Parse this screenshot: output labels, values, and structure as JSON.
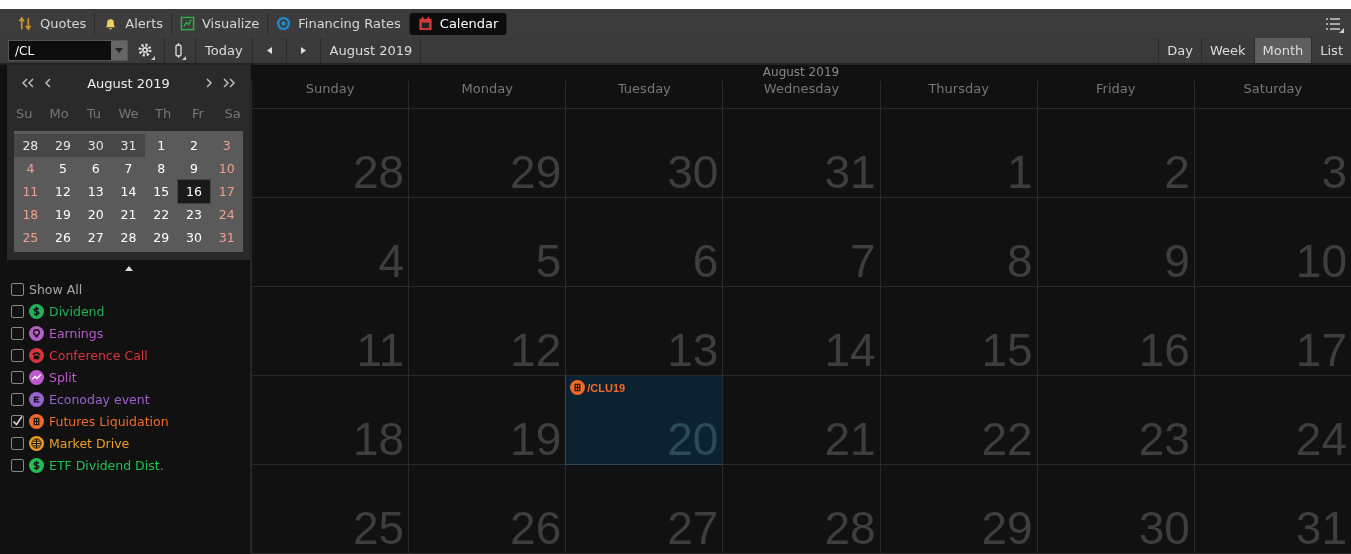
{
  "tabs": [
    {
      "label": "Quotes",
      "selected": false
    },
    {
      "label": "Alerts",
      "selected": false
    },
    {
      "label": "Visualize",
      "selected": false
    },
    {
      "label": "Financing Rates",
      "selected": false
    },
    {
      "label": "Calendar",
      "selected": true
    }
  ],
  "toolbar": {
    "symbol": "/CL",
    "today": "Today",
    "period": "August 2019"
  },
  "views": [
    {
      "label": "Day",
      "selected": false
    },
    {
      "label": "Week",
      "selected": false
    },
    {
      "label": "Month",
      "selected": true
    },
    {
      "label": "List",
      "selected": false
    }
  ],
  "mini_calendar": {
    "title": "August 2019",
    "weekdays": [
      "Su",
      "Mo",
      "Tu",
      "We",
      "Th",
      "Fr",
      "Sa"
    ],
    "weeks": [
      [
        {
          "day": "28",
          "other_month": true,
          "selected": false
        },
        {
          "day": "29",
          "other_month": true,
          "selected": false
        },
        {
          "day": "30",
          "other_month": true,
          "selected": false
        },
        {
          "day": "31",
          "other_month": true,
          "selected": false
        },
        {
          "day": "1",
          "other_month": false,
          "selected": false
        },
        {
          "day": "2",
          "other_month": false,
          "selected": false
        },
        {
          "day": "3",
          "other_month": false,
          "selected": false
        }
      ],
      [
        {
          "day": "4",
          "other_month": false,
          "selected": false
        },
        {
          "day": "5",
          "other_month": false,
          "selected": false
        },
        {
          "day": "6",
          "other_month": false,
          "selected": false
        },
        {
          "day": "7",
          "other_month": false,
          "selected": false
        },
        {
          "day": "8",
          "other_month": false,
          "selected": false
        },
        {
          "day": "9",
          "other_month": false,
          "selected": false
        },
        {
          "day": "10",
          "other_month": false,
          "selected": false
        }
      ],
      [
        {
          "day": "11",
          "other_month": false,
          "selected": false
        },
        {
          "day": "12",
          "other_month": false,
          "selected": false
        },
        {
          "day": "13",
          "other_month": false,
          "selected": false
        },
        {
          "day": "14",
          "other_month": false,
          "selected": false
        },
        {
          "day": "15",
          "other_month": false,
          "selected": false
        },
        {
          "day": "16",
          "other_month": false,
          "selected": true
        },
        {
          "day": "17",
          "other_month": false,
          "selected": false
        }
      ],
      [
        {
          "day": "18",
          "other_month": false,
          "selected": false
        },
        {
          "day": "19",
          "other_month": false,
          "selected": false
        },
        {
          "day": "20",
          "other_month": false,
          "selected": false
        },
        {
          "day": "21",
          "other_month": false,
          "selected": false
        },
        {
          "day": "22",
          "other_month": false,
          "selected": false
        },
        {
          "day": "23",
          "other_month": false,
          "selected": false
        },
        {
          "day": "24",
          "other_month": false,
          "selected": false
        }
      ],
      [
        {
          "day": "25",
          "other_month": false,
          "selected": false
        },
        {
          "day": "26",
          "other_month": false,
          "selected": false
        },
        {
          "day": "27",
          "other_month": false,
          "selected": false
        },
        {
          "day": "28",
          "other_month": false,
          "selected": false
        },
        {
          "day": "29",
          "other_month": false,
          "selected": false
        },
        {
          "day": "30",
          "other_month": false,
          "selected": false
        },
        {
          "day": "31",
          "other_month": false,
          "selected": false
        }
      ]
    ]
  },
  "filters": [
    {
      "label": "Show All",
      "checked": false
    },
    {
      "label": "Dividend",
      "checked": false,
      "color": "#1fb25a"
    },
    {
      "label": "Earnings",
      "checked": false,
      "color": "#b45ec8"
    },
    {
      "label": "Conference Call",
      "checked": false,
      "color": "#d8343c"
    },
    {
      "label": "Split",
      "checked": false,
      "color": "#c058d0"
    },
    {
      "label": "Econoday event",
      "checked": false,
      "color": "#9a62d0"
    },
    {
      "label": "Futures Liquidation",
      "checked": true,
      "color": "#f06a2a"
    },
    {
      "label": "Market Drive",
      "checked": false,
      "color": "#f0a020"
    },
    {
      "label": "ETF Dividend Dist.",
      "checked": false,
      "color": "#20c050"
    }
  ],
  "month_view": {
    "title": "August 2019",
    "weekdays": [
      "Sunday",
      "Monday",
      "Tuesday",
      "Wednesday",
      "Thursday",
      "Friday",
      "Saturday"
    ],
    "weeks": [
      [
        {
          "day": "28",
          "selected": false
        },
        {
          "day": "29",
          "selected": false
        },
        {
          "day": "30",
          "selected": false
        },
        {
          "day": "31",
          "selected": false
        },
        {
          "day": "1",
          "selected": false
        },
        {
          "day": "2",
          "selected": false
        },
        {
          "day": "3",
          "selected": false
        }
      ],
      [
        {
          "day": "4",
          "selected": false
        },
        {
          "day": "5",
          "selected": false
        },
        {
          "day": "6",
          "selected": false
        },
        {
          "day": "7",
          "selected": false
        },
        {
          "day": "8",
          "selected": false
        },
        {
          "day": "9",
          "selected": false
        },
        {
          "day": "10",
          "selected": false
        }
      ],
      [
        {
          "day": "11",
          "selected": false
        },
        {
          "day": "12",
          "selected": false
        },
        {
          "day": "13",
          "selected": false
        },
        {
          "day": "14",
          "selected": false
        },
        {
          "day": "15",
          "selected": false
        },
        {
          "day": "16",
          "selected": false
        },
        {
          "day": "17",
          "selected": false
        }
      ],
      [
        {
          "day": "18",
          "selected": false
        },
        {
          "day": "19",
          "selected": false
        },
        {
          "day": "20",
          "selected": true,
          "events": [
            {
              "label": "/CLU19",
              "color": "#f06a2a"
            }
          ]
        },
        {
          "day": "21",
          "selected": false
        },
        {
          "day": "22",
          "selected": false
        },
        {
          "day": "23",
          "selected": false
        },
        {
          "day": "24",
          "selected": false
        }
      ],
      [
        {
          "day": "25",
          "selected": false
        },
        {
          "day": "26",
          "selected": false
        },
        {
          "day": "27",
          "selected": false
        },
        {
          "day": "28",
          "selected": false
        },
        {
          "day": "29",
          "selected": false
        },
        {
          "day": "30",
          "selected": false
        },
        {
          "day": "31",
          "selected": false
        }
      ]
    ]
  }
}
